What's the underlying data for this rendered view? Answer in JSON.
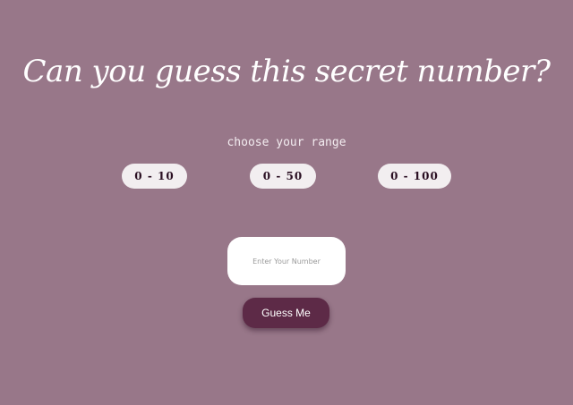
{
  "header": {
    "title": "Can you guess this secret number?"
  },
  "range": {
    "label": "choose your range",
    "options": [
      "0 - 10",
      "0 - 50",
      "0 - 100"
    ]
  },
  "guess_input": {
    "placeholder": "Enter Your Number",
    "value": ""
  },
  "guess_button": {
    "label": "Guess Me"
  },
  "colors": {
    "background": "#987789",
    "range_button_bg": "#f2eef0",
    "range_button_text": "#2a0f22",
    "guess_button_bg": "#5d2a47",
    "title_text": "#ffffff"
  }
}
